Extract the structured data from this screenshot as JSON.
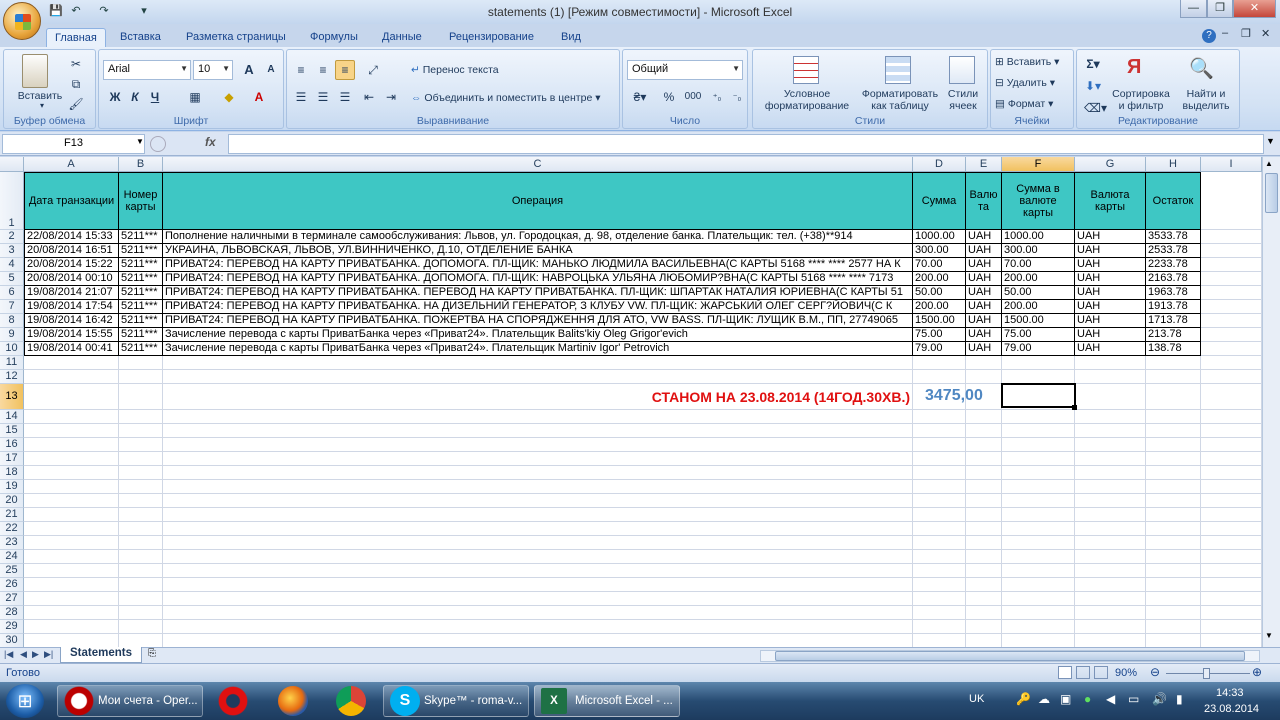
{
  "window": {
    "title": "statements (1)  [Режим совместимости] - Microsoft Excel",
    "minimize": "—",
    "restore": "❐",
    "close": "✕"
  },
  "qat": {
    "save": "💾",
    "undo": "↶",
    "redo": "↷",
    "customize": "▾"
  },
  "tabs": [
    "Главная",
    "Вставка",
    "Разметка страницы",
    "Формулы",
    "Данные",
    "Рецензирование",
    "Вид"
  ],
  "ribbon": {
    "clipboard": {
      "paste": "Вставить",
      "label": "Буфер обмена"
    },
    "font": {
      "name": "Arial",
      "size": "10",
      "bold": "Ж",
      "italic": "К",
      "underline": "Ч",
      "grow": "A",
      "shrink": "A",
      "label": "Шрифт"
    },
    "alignment": {
      "wrap": "Перенос текста",
      "merge": "Объединить и поместить в центре",
      "label": "Выравнивание"
    },
    "number": {
      "format": "Общий",
      "percent": "%",
      "thousands": "000",
      "label": "Число"
    },
    "styles": {
      "conditional": "Условное\nформатирование",
      "table": "Форматировать\nкак таблицу",
      "cell_styles": "Стили\nячеек",
      "label": "Стили"
    },
    "cells": {
      "insert": "Вставить",
      "delete": "Удалить",
      "format": "Формат",
      "label": "Ячейки"
    },
    "editing": {
      "sort": "Сортировка\nи фильтр",
      "find": "Найти и\nвыделить",
      "label": "Редактирование"
    }
  },
  "formula_bar": {
    "name_box": "F13",
    "fx": "fx",
    "value": ""
  },
  "columns": [
    "A",
    "B",
    "C",
    "D",
    "E",
    "F",
    "G",
    "H",
    "I"
  ],
  "header_row": {
    "a": "Дата транзакции",
    "b": "Номер карты",
    "c": "Операция",
    "d": "Сумма",
    "e": "Валю та",
    "f": "Сумма в валюте карты",
    "g": "Валюта карты",
    "h": "Остаток"
  },
  "rows": [
    {
      "a": "22/08/2014 15:33",
      "b": "5211***",
      "c": "Пополнение наличными в терминале самообслуживания: Львов, ул. Городоцкая, д. 98, отделение банка. Плательщик: тел. (+38)**914",
      "d": "1000.00",
      "e": "UAH",
      "f": "1000.00",
      "g": "UAH",
      "h": "3533.78"
    },
    {
      "a": "20/08/2014 16:51",
      "b": "5211***",
      "c": "УКРАИНА, ЛЬВОВСКАЯ, ЛЬВОВ, УЛ.ВИННИЧЕНКО, Д.10, ОТДЕЛЕНИЕ БАНКА",
      "d": "300.00",
      "e": "UAH",
      "f": "300.00",
      "g": "UAH",
      "h": "2533.78"
    },
    {
      "a": "20/08/2014 15:22",
      "b": "5211***",
      "c": "ПРИВАТ24: ПЕРЕВОД НА КАРТУ ПРИВАТБАНКА. ДОПОМОГА.  ПЛ-ЩИК: МАНЬКО ЛЮДМИЛА ВАСИЛЬЕВНА(С КАРТЫ 5168 **** **** 2577 НА К",
      "d": "70.00",
      "e": "UAH",
      "f": "70.00",
      "g": "UAH",
      "h": "2233.78"
    },
    {
      "a": "20/08/2014 00:10",
      "b": "5211***",
      "c": "ПРИВАТ24: ПЕРЕВОД НА КАРТУ ПРИВАТБАНКА. ДОПОМОГА.  ПЛ-ЩИК: НАВРОЦЬКА УЛЬЯНА ЛЮБОМИР?ВНА(С КАРТЫ 5168 **** **** 7173",
      "d": "200.00",
      "e": "UAH",
      "f": "200.00",
      "g": "UAH",
      "h": "2163.78"
    },
    {
      "a": "19/08/2014 21:07",
      "b": "5211***",
      "c": "ПРИВАТ24: ПЕРЕВОД НА КАРТУ ПРИВАТБАНКА. ПЕРЕВОД НА КАРТУ ПРИВАТБАНКА.  ПЛ-ЩИК: ШПАРТАК НАТАЛИЯ ЮРИЕВНА(С КАРТЫ 51",
      "d": "50.00",
      "e": "UAH",
      "f": "50.00",
      "g": "UAH",
      "h": "1963.78"
    },
    {
      "a": "19/08/2014 17:54",
      "b": "5211***",
      "c": "ПРИВАТ24: ПЕРЕВОД НА КАРТУ ПРИВАТБАНКА. НА ДИЗЕЛЬНИЙ ГЕНЕРАТОР, З КЛУБУ VW.  ПЛ-ЩИК: ЖАРСЬКИЙ ОЛЕГ СЕРГ?ЙОВИЧ(С К",
      "d": "200.00",
      "e": "UAH",
      "f": "200.00",
      "g": "UAH",
      "h": "1913.78"
    },
    {
      "a": "19/08/2014 16:42",
      "b": "5211***",
      "c": "ПРИВАТ24: ПЕРЕВОД НА КАРТУ ПРИВАТБАНКА. ПОЖЕРТВА НА СПОРЯДЖЕННЯ ДЛЯ АТО, VW BASS.  ПЛ-ЩИК: ЛУЩИК В.М., ПП, 27749065",
      "d": "1500.00",
      "e": "UAH",
      "f": "1500.00",
      "g": "UAH",
      "h": "1713.78"
    },
    {
      "a": "19/08/2014 15:55",
      "b": "5211***",
      "c": "Зачисление перевода с карты ПриватБанка через «Приват24». Плательщик Balits'kiy Oleg Grigor'evich",
      "d": "75.00",
      "e": "UAH",
      "f": "75.00",
      "g": "UAH",
      "h": "213.78"
    },
    {
      "a": "19/08/2014 00:41",
      "b": "5211***",
      "c": "Зачисление перевода с карты ПриватБанка через «Приват24». Плательщик Martiniv Igor' Petrovich",
      "d": "79.00",
      "e": "UAH",
      "f": "79.00",
      "g": "UAH",
      "h": "138.78"
    }
  ],
  "row_numbers": [
    "1",
    "2",
    "3",
    "4",
    "5",
    "6",
    "7",
    "8",
    "9",
    "10",
    "11",
    "12",
    "13",
    "14",
    "15",
    "16",
    "17",
    "18",
    "19",
    "20",
    "21",
    "22",
    "23",
    "24",
    "25",
    "26",
    "27",
    "28",
    "29",
    "30"
  ],
  "summary": {
    "label": "СТАНОМ НА 23.08.2014 (14ГОД.30ХВ.)",
    "value": "3475,00"
  },
  "sheet_tabs": [
    "Statements"
  ],
  "status": {
    "ready": "Готово",
    "zoom": "90%"
  },
  "taskbar": {
    "start": "⊞",
    "items": [
      {
        "label": "Мои счета - Oper..."
      },
      {
        "label": "Skype™ - roma-v..."
      },
      {
        "label": "Microsoft Excel - ..."
      }
    ],
    "lang": "UK",
    "time": "14:33",
    "date": "23.08.2014"
  },
  "colors": {
    "header_fill": "#3ec7c4",
    "summary_label": "#e01010",
    "summary_value": "#4f87c2"
  }
}
